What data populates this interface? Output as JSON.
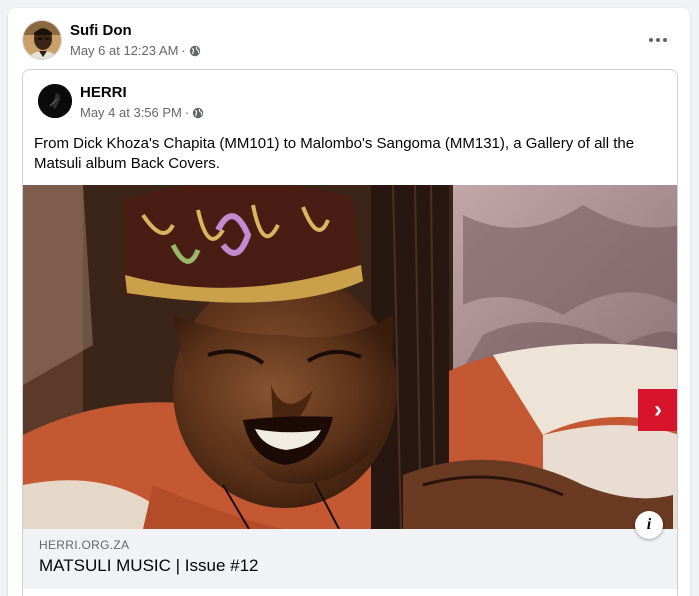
{
  "post": {
    "author": "Sufi Don",
    "timestamp": "May 6 at 12:23 AM",
    "separator": "·",
    "audience_icon": "globe-icon",
    "more_icon": "more-horizontal-icon"
  },
  "shared_post": {
    "author": "HERRI",
    "timestamp": "May 4 at 3:56 PM",
    "separator": "·",
    "audience_icon": "globe-icon",
    "text": "From Dick Khoza's Chapita (MM101) to Malombo's Sangoma (MM131), a Gallery of all the Matsuli album Back Covers.",
    "next_icon": "chevron-right-icon",
    "next_label": "›",
    "info_label": "i",
    "accent": "#d7142c",
    "link": {
      "domain": "HERRI.ORG.ZA",
      "title": "MATSULI MUSIC | Issue #12"
    }
  }
}
